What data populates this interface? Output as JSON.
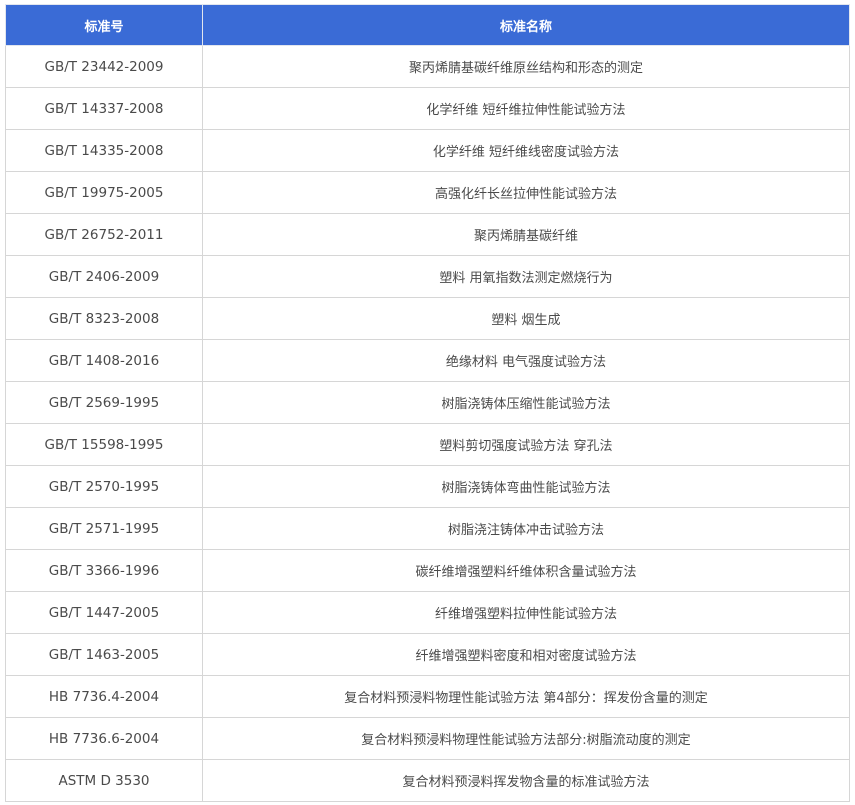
{
  "table": {
    "headers": {
      "code": "标准号",
      "name": "标准名称"
    },
    "rows": [
      {
        "code": "GB/T 23442-2009",
        "name": "聚丙烯腈基碳纤维原丝结构和形态的测定"
      },
      {
        "code": "GB/T 14337-2008",
        "name": "化学纤维 短纤维拉伸性能试验方法"
      },
      {
        "code": "GB/T 14335-2008",
        "name": "化学纤维 短纤维线密度试验方法"
      },
      {
        "code": "GB/T 19975-2005",
        "name": "高强化纤长丝拉伸性能试验方法"
      },
      {
        "code": "GB/T 26752-2011",
        "name": "聚丙烯腈基碳纤维"
      },
      {
        "code": "GB/T 2406-2009",
        "name": "塑料 用氧指数法测定燃烧行为"
      },
      {
        "code": "GB/T 8323-2008",
        "name": "塑料 烟生成"
      },
      {
        "code": "GB/T 1408-2016",
        "name": "绝缘材料 电气强度试验方法"
      },
      {
        "code": "GB/T 2569-1995",
        "name": "树脂浇铸体压缩性能试验方法"
      },
      {
        "code": "GB/T 15598-1995",
        "name": "塑料剪切强度试验方法 穿孔法"
      },
      {
        "code": "GB/T 2570-1995",
        "name": "树脂浇铸体弯曲性能试验方法"
      },
      {
        "code": "GB/T 2571-1995",
        "name": "树脂浇注铸体冲击试验方法"
      },
      {
        "code": "GB/T 3366-1996",
        "name": "碳纤维增强塑料纤维体积含量试验方法"
      },
      {
        "code": "GB/T 1447-2005",
        "name": "纤维增强塑料拉伸性能试验方法"
      },
      {
        "code": "GB/T 1463-2005",
        "name": "纤维增强塑料密度和相对密度试验方法"
      },
      {
        "code": "HB 7736.4-2004",
        "name": "复合材料预浸料物理性能试验方法 第4部分：挥发份含量的测定"
      },
      {
        "code": "HB 7736.6-2004",
        "name": "复合材料预浸料物理性能试验方法部分:树脂流动度的测定"
      },
      {
        "code": "ASTM D 3530",
        "name": "复合材料预浸料挥发物含量的标准试验方法"
      }
    ]
  }
}
